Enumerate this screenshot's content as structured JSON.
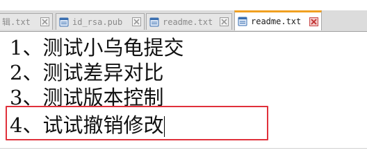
{
  "tabs": [
    {
      "label": "辑.txt",
      "active": false,
      "icon": "text-file-icon",
      "close_icon": "close-icon"
    },
    {
      "label": "id_rsa.pub",
      "active": false,
      "icon": "text-file-icon",
      "close_icon": "close-icon"
    },
    {
      "label": "readme.txt",
      "active": false,
      "icon": "text-file-icon",
      "close_icon": "close-icon"
    },
    {
      "label": "readme.txt",
      "active": true,
      "icon": "text-file-icon",
      "close_icon": "close-icon"
    }
  ],
  "editor": {
    "lines": [
      "1、测试小乌龟提交",
      "2、测试差异对比",
      "3、测试版本控制",
      "4、试试撤销修改"
    ]
  },
  "colors": {
    "active_tab_accent": "#f0a020",
    "highlight_border": "#e0303a",
    "close_button": "#e05050",
    "file_icon": "#3a6fb0"
  }
}
